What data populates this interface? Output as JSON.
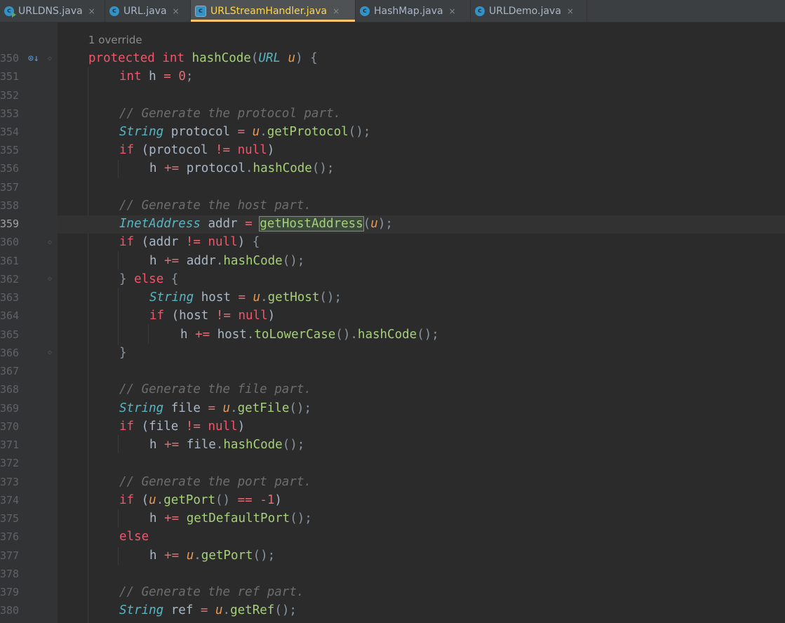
{
  "tabs": [
    {
      "label": "URLDNS.java",
      "icon": "java-class-run-icon",
      "active": false
    },
    {
      "label": "URL.java",
      "icon": "java-class-icon",
      "active": false
    },
    {
      "label": "URLStreamHandler.java",
      "icon": "java-class-abstract-icon",
      "active": true
    },
    {
      "label": "HashMap.java",
      "icon": "java-class-icon",
      "active": false
    },
    {
      "label": "URLDemo.java",
      "icon": "java-class-icon",
      "active": false
    }
  ],
  "close_glyph": "×",
  "editor": {
    "hint": "1 override",
    "current_line": 359,
    "line_numbers": [
      "350",
      "351",
      "352",
      "353",
      "354",
      "355",
      "356",
      "357",
      "358",
      "359",
      "360",
      "361",
      "362",
      "363",
      "364",
      "365",
      "366",
      "367",
      "368",
      "369",
      "370",
      "371",
      "372",
      "373",
      "374",
      "375",
      "376",
      "377",
      "378",
      "379",
      "380"
    ]
  }
}
